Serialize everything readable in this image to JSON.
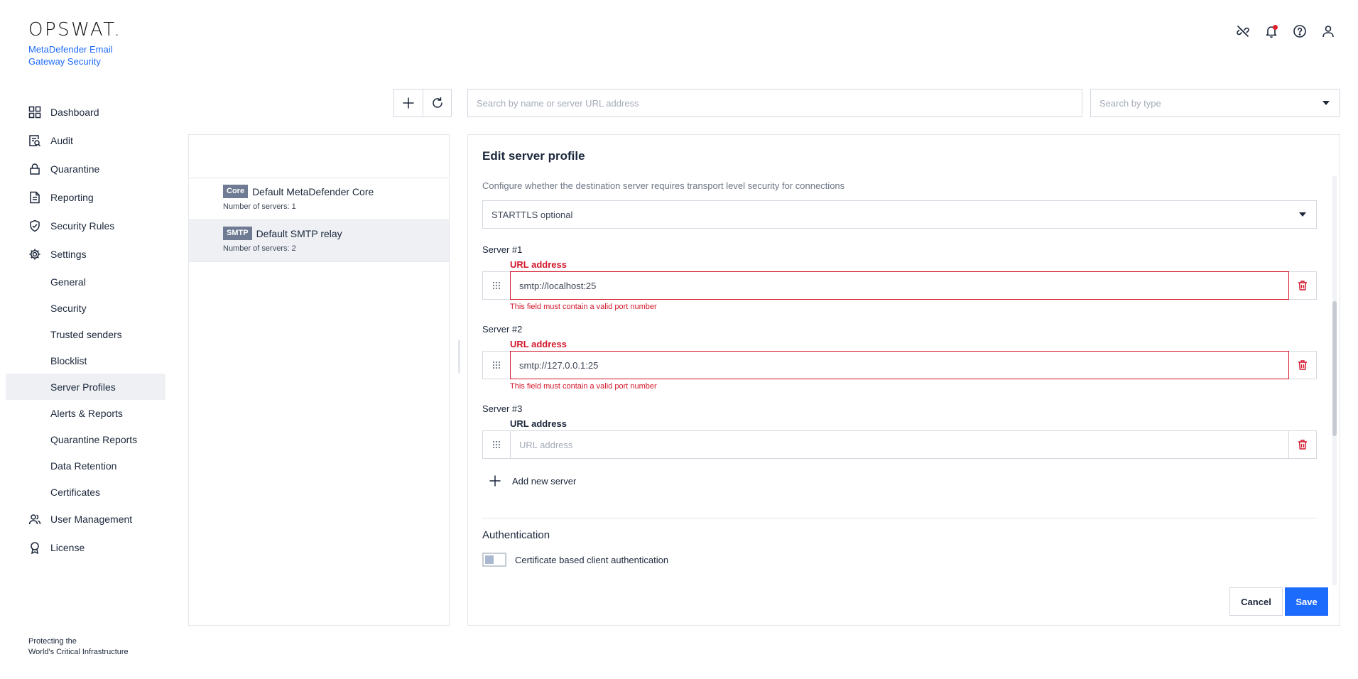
{
  "header": {
    "logo_text": "OPSWAT.",
    "product_name": "MetaDefender Email Gateway Security",
    "icons": [
      "unlink-icon",
      "bell-icon",
      "help-icon",
      "user-icon"
    ]
  },
  "sidebar": {
    "items": [
      {
        "label": "Dashboard",
        "icon": "dashboard-icon"
      },
      {
        "label": "Audit",
        "icon": "audit-icon"
      },
      {
        "label": "Quarantine",
        "icon": "lock-icon"
      },
      {
        "label": "Reporting",
        "icon": "document-icon"
      },
      {
        "label": "Security Rules",
        "icon": "shield-check-icon"
      },
      {
        "label": "Settings",
        "icon": "gear-icon"
      }
    ],
    "settings_children": [
      {
        "label": "General"
      },
      {
        "label": "Security"
      },
      {
        "label": "Trusted senders"
      },
      {
        "label": "Blocklist"
      },
      {
        "label": "Server Profiles",
        "active": true
      },
      {
        "label": "Alerts & Reports"
      },
      {
        "label": "Quarantine Reports"
      },
      {
        "label": "Data Retention"
      },
      {
        "label": "Certificates"
      }
    ],
    "bottom_items": [
      {
        "label": "User Management",
        "icon": "users-icon"
      },
      {
        "label": "License",
        "icon": "badge-icon"
      }
    ],
    "footer_line1": "Protecting the",
    "footer_line2": "World's Critical Infrastructure"
  },
  "toolbar": {
    "search_placeholder": "Search by name or server URL address",
    "type_placeholder": "Search by type"
  },
  "profiles": [
    {
      "type": "Core",
      "name": "Default MetaDefender Core",
      "servers": "Number of servers: 1",
      "selected": false
    },
    {
      "type": "SMTP",
      "name": "Default SMTP relay",
      "servers": "Number of servers: 2",
      "selected": true
    }
  ],
  "edit": {
    "title": "Edit server profile",
    "tls_help": "Configure whether the destination server requires transport level security for connections",
    "tls_value": "STARTTLS optional",
    "servers": [
      {
        "label": "Server #1",
        "url_label": "URL address",
        "value": "smtp://localhost:25",
        "error": "This field must contain a valid port number"
      },
      {
        "label": "Server #2",
        "url_label": "URL address",
        "value": "smtp://127.0.0.1:25",
        "error": "This field must contain a valid port number"
      },
      {
        "label": "Server #3",
        "url_label": "URL address",
        "value": "",
        "placeholder": "URL address",
        "error": ""
      }
    ],
    "add_server_label": "Add new server",
    "auth_title": "Authentication",
    "cert_auth_label": "Certificate based client authentication",
    "cert_auth_enabled": false,
    "cancel_label": "Cancel",
    "save_label": "Save"
  },
  "colors": {
    "accent": "#1d6bfc",
    "error": "#d3172a",
    "badge": "#6e7b93",
    "selected_bg": "#eef0f4"
  }
}
